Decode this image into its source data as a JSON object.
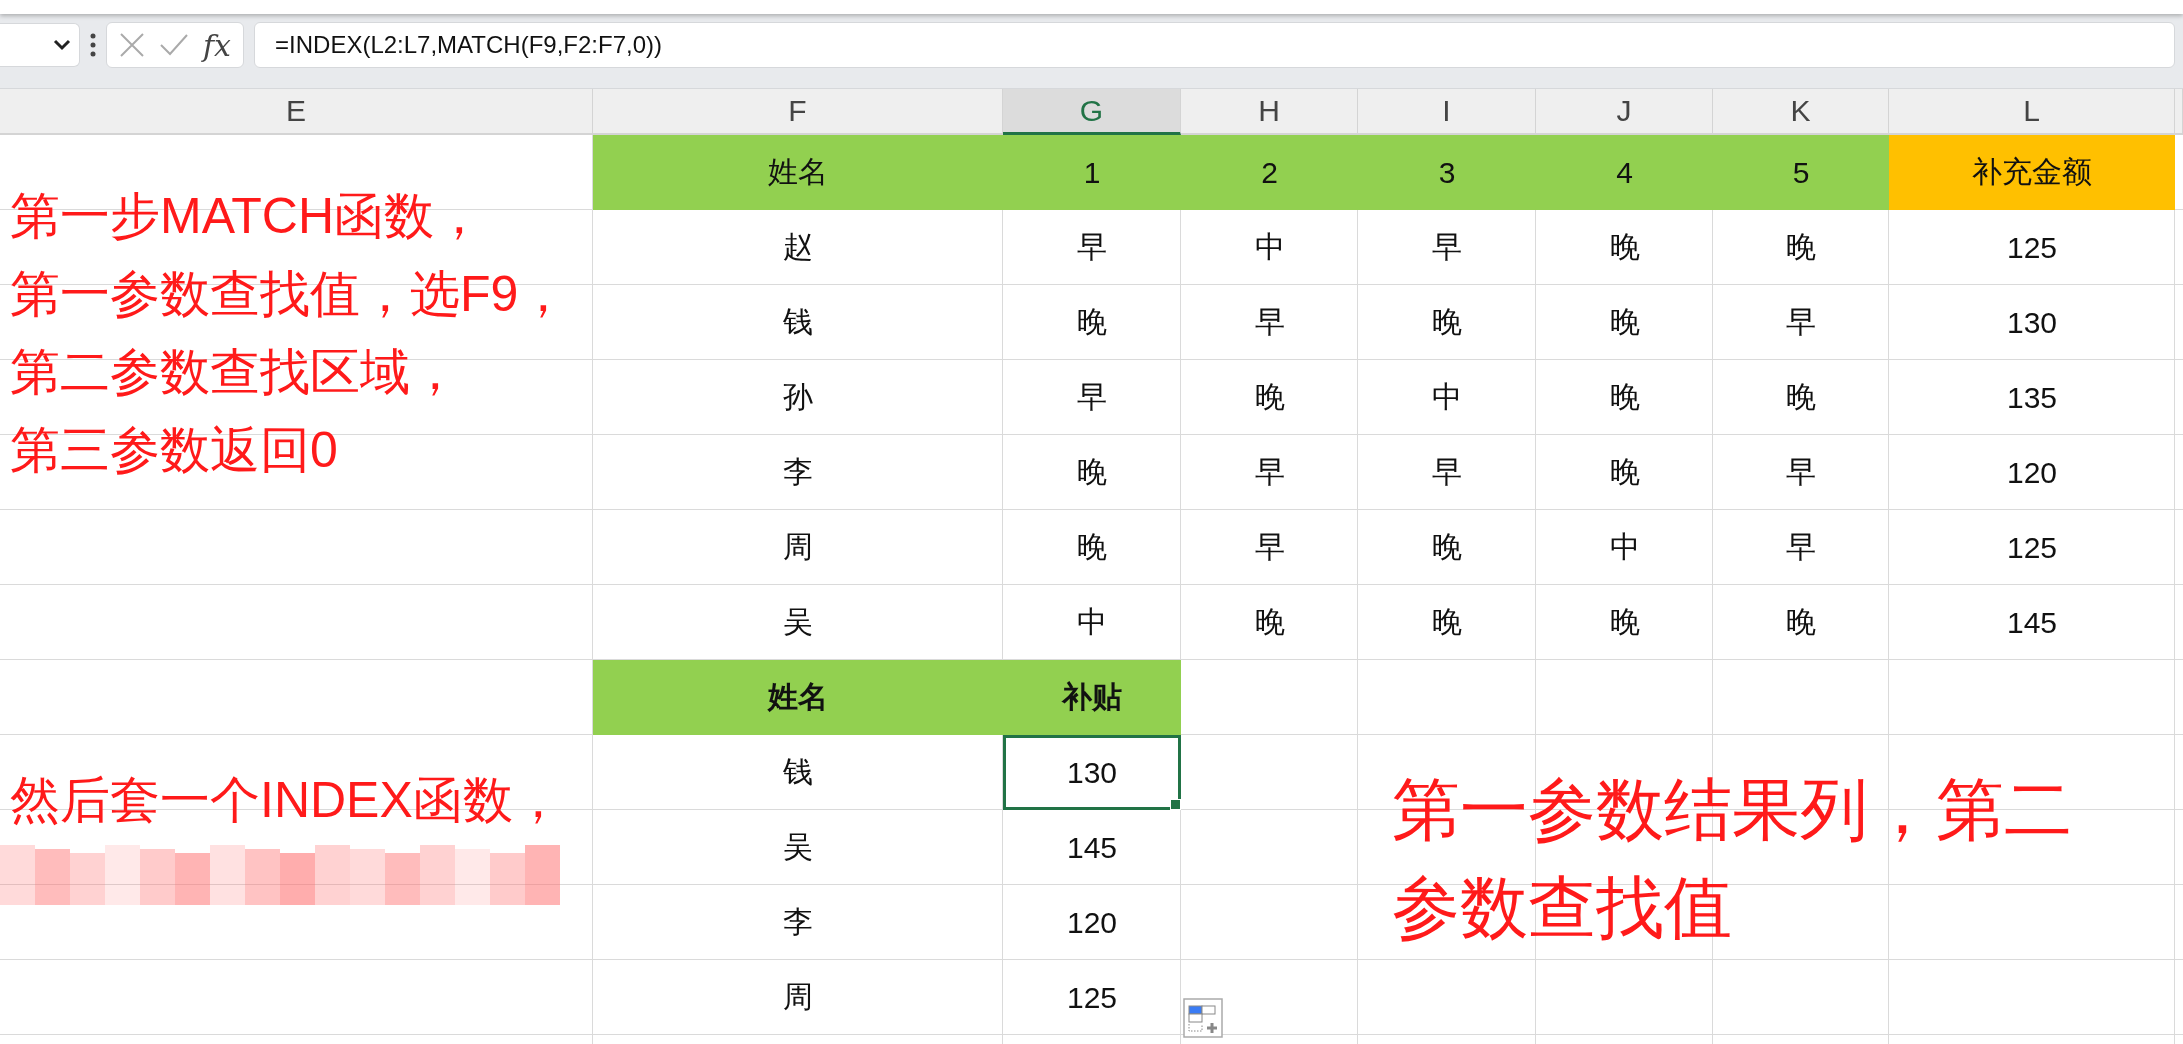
{
  "formula_bar": {
    "fx": "fx",
    "formula": "=INDEX(L2:L7,MATCH(F9,F2:F7,0))"
  },
  "column_headers": [
    {
      "label": "E",
      "selected": false
    },
    {
      "label": "F",
      "selected": false
    },
    {
      "label": "G",
      "selected": true
    },
    {
      "label": "H",
      "selected": false
    },
    {
      "label": "I",
      "selected": false
    },
    {
      "label": "J",
      "selected": false
    },
    {
      "label": "K",
      "selected": false
    },
    {
      "label": "L",
      "selected": false
    }
  ],
  "table": {
    "columns": [
      {
        "label": "姓名",
        "color": "#92d050"
      },
      {
        "label": "1",
        "color": "#92d050"
      },
      {
        "label": "2",
        "color": "#92d050"
      },
      {
        "label": "3",
        "color": "#92d050"
      },
      {
        "label": "4",
        "color": "#92d050"
      },
      {
        "label": "5",
        "color": "#92d050"
      },
      {
        "label": "补充金额",
        "color": "#ffc000"
      }
    ],
    "rows": [
      [
        "赵",
        "早",
        "中",
        "早",
        "晚",
        "晚",
        "125"
      ],
      [
        "钱",
        "晚",
        "早",
        "晚",
        "晚",
        "早",
        "130"
      ],
      [
        "孙",
        "早",
        "晚",
        "中",
        "晚",
        "晚",
        "135"
      ],
      [
        "李",
        "晚",
        "早",
        "早",
        "晚",
        "早",
        "120"
      ],
      [
        "周",
        "晚",
        "早",
        "晚",
        "中",
        "早",
        "125"
      ],
      [
        "吴",
        "中",
        "晚",
        "晚",
        "晚",
        "晚",
        "145"
      ]
    ]
  },
  "lookup": {
    "columns": [
      "姓名",
      "补贴"
    ],
    "rows": [
      {
        "name": "钱",
        "value": "130",
        "selected": true
      },
      {
        "name": "吴",
        "value": "145",
        "selected": false
      },
      {
        "name": "李",
        "value": "120",
        "selected": false
      },
      {
        "name": "周",
        "value": "125",
        "selected": false
      }
    ]
  },
  "annotations": [
    {
      "lines": [
        "第一步MATCH函数，",
        "第一参数查找值，选F9，",
        "第二参数查找区域，",
        "第三参数返回0"
      ]
    },
    {
      "lines": [
        "然后套一个INDEX函数，"
      ]
    },
    {
      "lines": [
        "第一参数结果列，第二",
        "参数查找值"
      ]
    }
  ]
}
